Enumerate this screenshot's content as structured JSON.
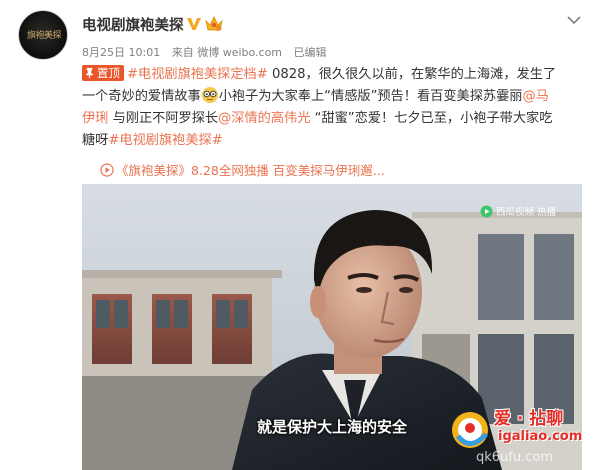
{
  "header": {
    "author_name": "电视剧旗袍美探",
    "avatar_icon": "drama-logo-avatar",
    "date": "8月25日 10:01",
    "source": "来自 微博 weibo.com",
    "edit_status": "已编辑"
  },
  "post": {
    "pin_label": "置顶",
    "hashtag_main": "#电视剧旗袍美探定档#",
    "line1_text": " 0828，很久很久以前，在繁华的上海滩，发生了",
    "line2_a": "一个奇妙的爱情故事",
    "line2_b": "小袍子为大家奉上“情感版”预告！看百变美探苏霎丽",
    "line2_mention": "@马",
    "line3_mention_end": "伊琍",
    "line4_a": " 与刚正不阿罗探长",
    "line4_mention": "@深情的高伟光",
    "line4_b": " “甜蜜”恋爱！七夕已至，小袍子带大家吃",
    "line5_a": "糖呀",
    "hashtag_end": "#电视剧旗袍美探#"
  },
  "video": {
    "link_text": "《旗袍美探》8.28全网独播 百变美探马伊琍邂...",
    "channel_watermark": "西瓜视频 热播",
    "subtitle": "就是保护大上海的安全"
  },
  "site_watermark": {
    "brand": "爱 · 拈聊",
    "url": "igaliao.com",
    "url2": "qk6ufu.com"
  },
  "colors": {
    "link": "#eb7350",
    "pin_badge": "#e8562a",
    "verified": "#f5a623"
  }
}
